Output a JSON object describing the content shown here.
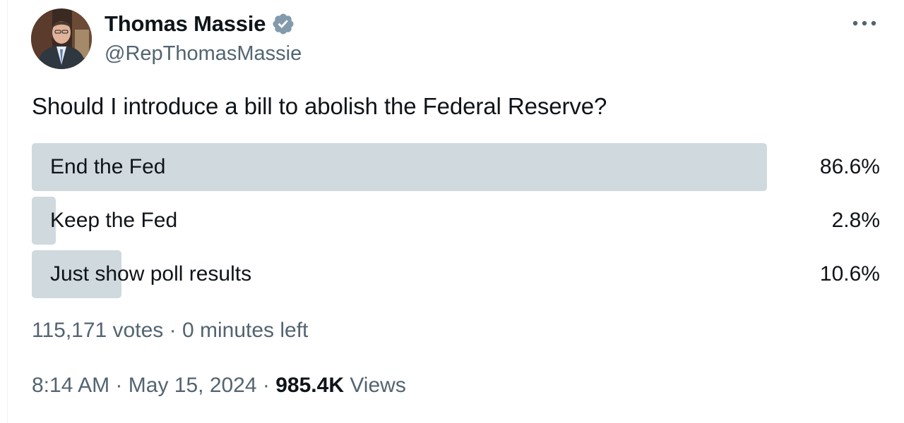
{
  "author": {
    "display_name": "Thomas Massie",
    "handle": "@RepThomasMassie",
    "verified_icon": "verified-badge-icon",
    "avatar": "profile-photo"
  },
  "menu_icon": "more-horizontal-icon",
  "tweet": {
    "text": "Should I introduce a bill to abolish the Federal Reserve?"
  },
  "poll": {
    "options": [
      {
        "label": "End the Fed",
        "percent_text": "86.6%",
        "percent": 86.6
      },
      {
        "label": "Keep the Fed",
        "percent_text": "2.8%",
        "percent": 2.8
      },
      {
        "label": "Just show poll results",
        "percent_text": "10.6%",
        "percent": 10.6
      }
    ],
    "votes": "115,171 votes",
    "separator": "·",
    "time_left": "0 minutes left"
  },
  "footer": {
    "time": "8:14 AM",
    "date": "May 15, 2024",
    "views_count": "985.4K",
    "views_label": "Views",
    "separator": "·"
  },
  "colors": {
    "poll_fill": "#cfd9de",
    "secondary_text": "#536471",
    "primary_text": "#0f1419",
    "verified_badge": "#829aab"
  }
}
